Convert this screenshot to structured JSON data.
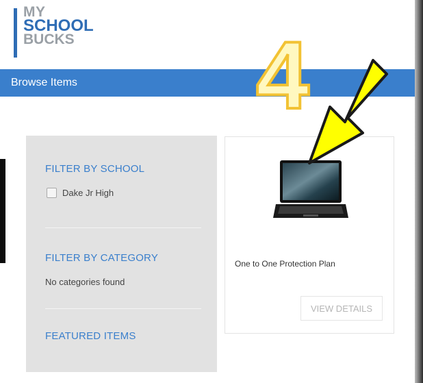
{
  "logo": {
    "line1": "MY",
    "line2": "SCHOOL",
    "line3": "BUCKS"
  },
  "header": {
    "title": "Browse Items"
  },
  "filters": {
    "school_heading": "FILTER BY SCHOOL",
    "school_option": "Dake Jr High",
    "category_heading": "FILTER BY CATEGORY",
    "category_empty": "No categories found",
    "featured_heading": "FEATURED ITEMS"
  },
  "product": {
    "name": "One to One Protection Plan",
    "button_label": "VIEW DETAILS",
    "image_icon": "laptop-icon"
  },
  "annotation": {
    "number": "4",
    "arrow": "arrow-down-left-icon"
  },
  "colors": {
    "brand_blue": "#3a7fcc",
    "annotation_yellow": "#ffff00"
  }
}
